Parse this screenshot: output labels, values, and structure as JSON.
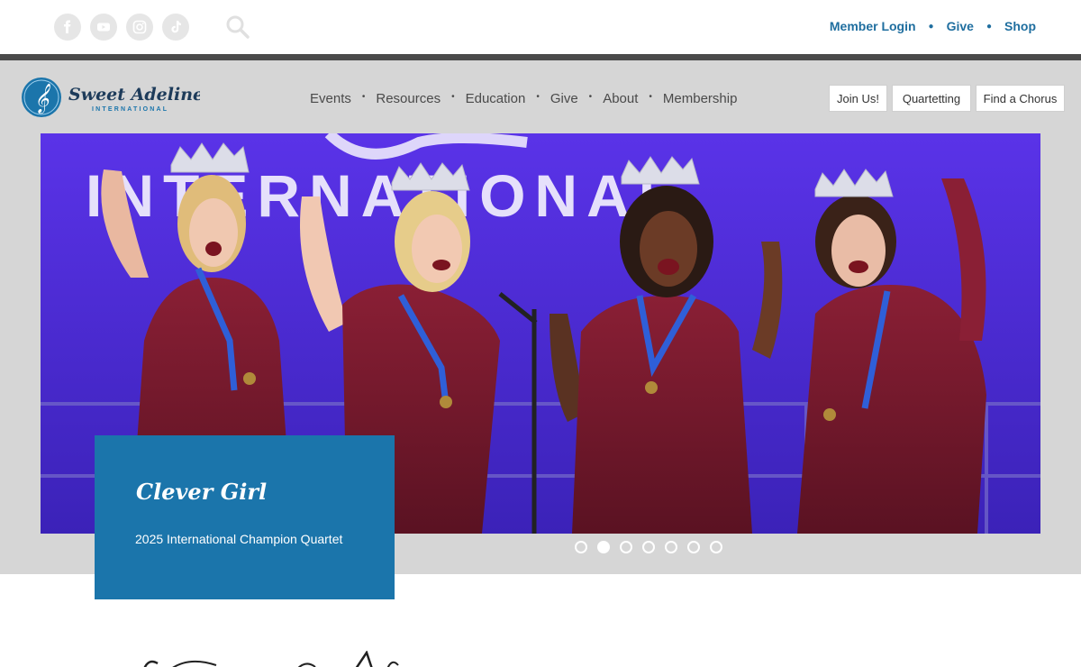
{
  "social": [
    {
      "icon": "facebook-icon"
    },
    {
      "icon": "youtube-icon"
    },
    {
      "icon": "instagram-icon"
    },
    {
      "icon": "tiktok-icon"
    }
  ],
  "top_links": {
    "member_login": "Member Login",
    "give": "Give",
    "shop": "Shop"
  },
  "brand": {
    "name": "Sweet Adelines",
    "sub": "INTERNATIONAL"
  },
  "nav": {
    "events": "Events",
    "resources": "Resources",
    "education": "Education",
    "give": "Give",
    "about": "About",
    "membership": "Membership"
  },
  "cta": {
    "join": "Join Us!",
    "quartetting": "Quartetting",
    "find_chorus": "Find a Chorus"
  },
  "hero": {
    "backdrop_text": "INTERNATIONAL",
    "title": "Clever Girl",
    "subtitle": "2025 International Champion Quartet"
  },
  "carousel": {
    "slides": 7,
    "active_index": 1
  },
  "colors": {
    "accent_blue": "#1b75ab",
    "link_blue": "#1f6e9f",
    "band_gray": "#d6d6d6",
    "stage_purple": "#4a2bdc"
  }
}
